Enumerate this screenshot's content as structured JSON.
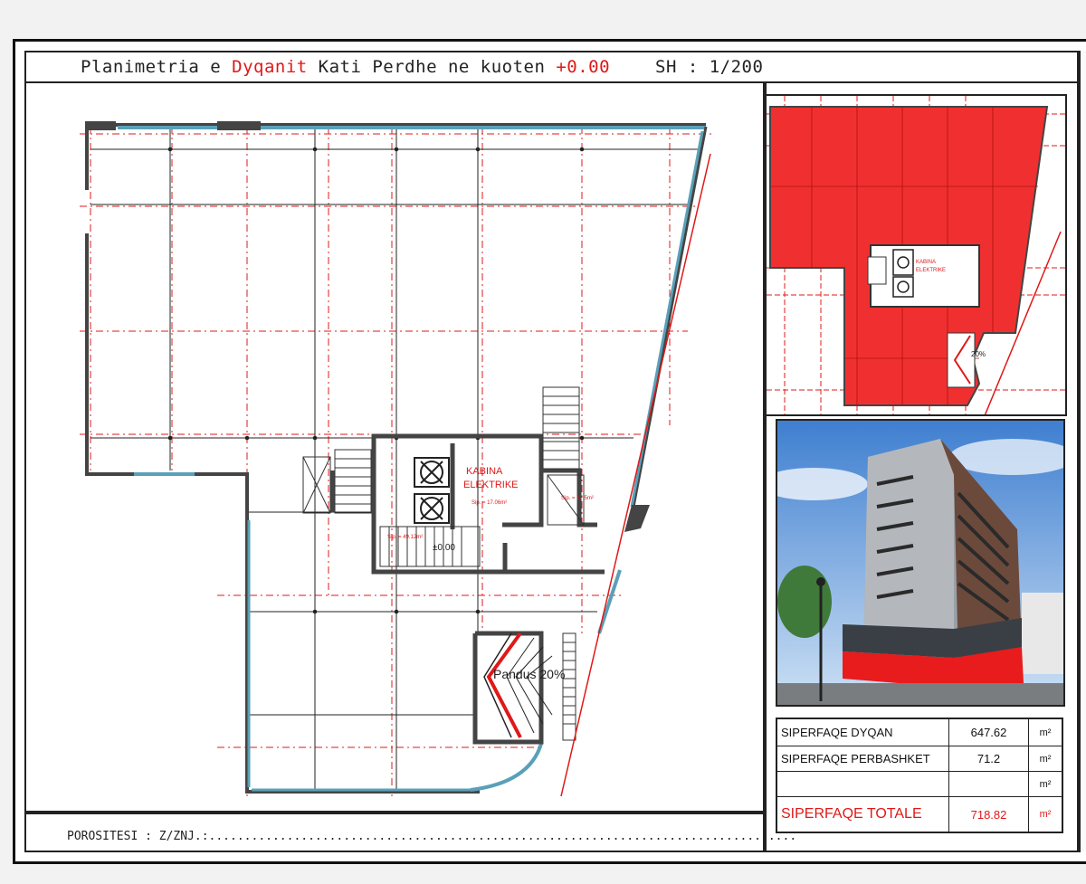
{
  "title": {
    "part1": "Planimetria e ",
    "part2": "Dyqanit",
    "part3": " Kati Perdhe ne kuoten ",
    "part4": "+0.00",
    "scale": "SH :  1/200"
  },
  "plan_labels": {
    "room1_line1": "KABINA",
    "room1_line2": "ELEKTRIKE",
    "room1_area": "Sip. = 17.06m²",
    "stair_area": "Sip. = 49.12m²",
    "level": "±0.00",
    "ramp": "Pandus 20%",
    "small_area": "Sip. = 17.5m²",
    "thumb_ramp": "20%",
    "thumb_room1": "KABINA",
    "thumb_room2": "ELEKTRIKE"
  },
  "footer": {
    "client": "POROSITESI :  Z/ZNJ.:..................................................................................."
  },
  "areas": [
    {
      "label": "SIPERFAQE DYQAN",
      "value": "647.62",
      "unit": "m²"
    },
    {
      "label": "SIPERFAQE PERBASHKET",
      "value": "71.2",
      "unit": "m²"
    },
    {
      "label": "",
      "value": "",
      "unit": "m²"
    },
    {
      "label": "SIPERFAQE TOTALE",
      "value": "718.82",
      "unit": "m²"
    }
  ],
  "colors": {
    "accent_red": "#e01818",
    "wall_blue": "#5aa0b8",
    "highlight_fill": "#f03030"
  }
}
